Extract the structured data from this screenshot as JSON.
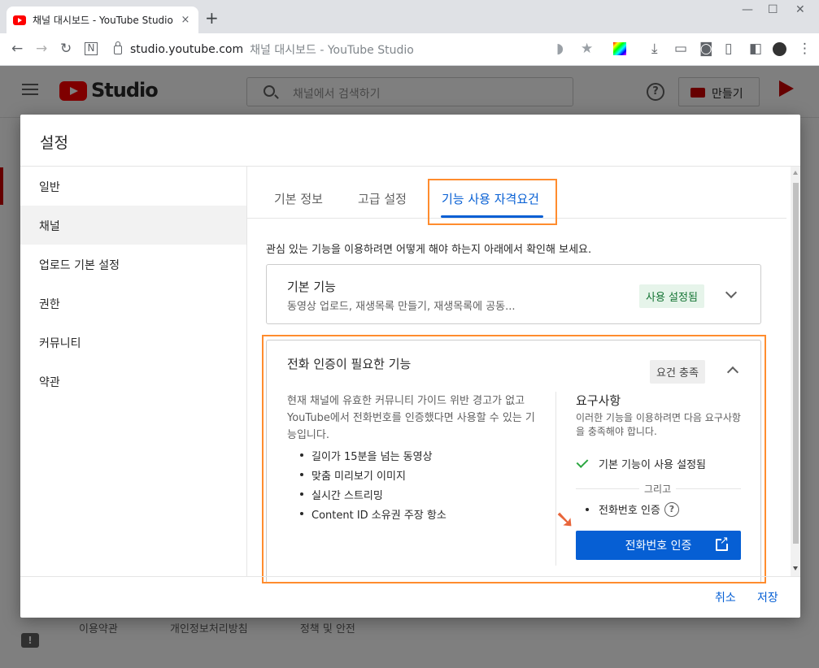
{
  "browser": {
    "tab_title": "채널 대시보드 - YouTube Studio",
    "tab_close": "×",
    "new_tab": "+",
    "url": "studio.youtube.com",
    "url_title": "채널 대시보드 - YouTube Studio"
  },
  "studio": {
    "logo_text": "Studio",
    "search_placeholder": "채널에서 검색하기",
    "help": "?",
    "create_label": "만들기",
    "footer_links": [
      "이용약관",
      "개인정보처리방침",
      "정책 및 안전"
    ],
    "feedback_icon": "!"
  },
  "dialog": {
    "title": "설정",
    "sidebar": [
      {
        "label": "일반"
      },
      {
        "label": "채널"
      },
      {
        "label": "업로드 기본 설정"
      },
      {
        "label": "권한"
      },
      {
        "label": "커뮤니티"
      },
      {
        "label": "약관"
      }
    ],
    "active_sidebar": "채널",
    "tabs": [
      {
        "label": "기본 정보"
      },
      {
        "label": "고급 설정"
      },
      {
        "label": "기능 사용 자격요건"
      }
    ],
    "active_tab": "기능 사용 자격요건",
    "intro": "관심 있는 기능을 이용하려면 어떻게 해야 하는지 아래에서 확인해 보세요.",
    "card_basic": {
      "title": "기본 기능",
      "subtitle": "동영상 업로드, 재생목록 만들기, 재생목록에 공동...",
      "status": "사용 설정됨"
    },
    "card_phone": {
      "title": "전화 인증이 필요한 기능",
      "status": "요건 충족",
      "description": "현재 채널에 유효한 커뮤니티 가이드 위반 경고가 없고 YouTube에서 전화번호를 인증했다면 사용할 수 있는 기능입니다.",
      "features": [
        "길이가 15분을 넘는 동영상",
        "맞춤 미리보기 이미지",
        "실시간 스트리밍",
        "Content ID 소유권 주장 항소"
      ],
      "requirements_title": "요구사항",
      "requirements_sub": "이러한 기능을 이용하려면 다음 요구사항을 충족해야 합니다.",
      "req_met": "기본 기능이 사용 설정됨",
      "and_label": "그리고",
      "req_phone": "전화번호 인증",
      "verify_button": "전화번호 인증"
    },
    "cancel": "취소",
    "save": "저장"
  },
  "colors": {
    "accent": "#065fd4",
    "highlight": "#ff8c2e",
    "annotation_arrow": "#e8653a",
    "success": "#2ba640"
  }
}
